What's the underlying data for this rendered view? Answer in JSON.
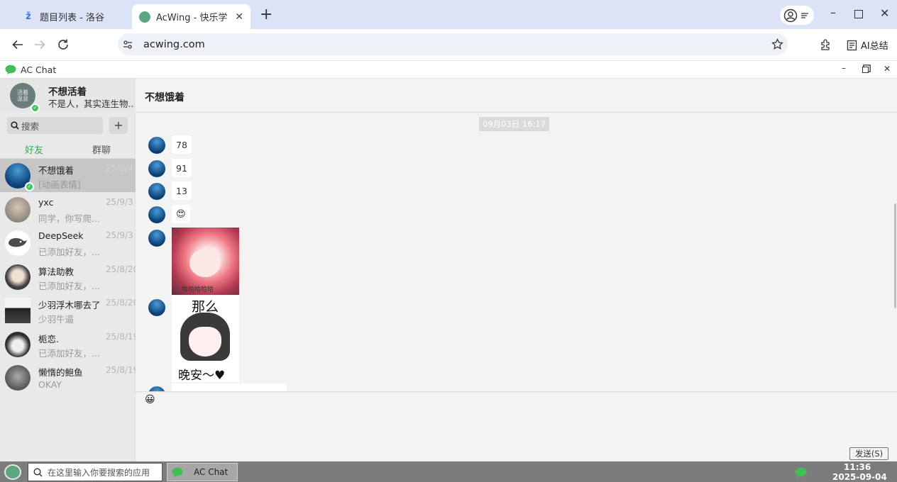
{
  "browser": {
    "tabs": [
      {
        "title": "题目列表 - 洛谷",
        "active": false
      },
      {
        "title": "AcWing - 快乐学习",
        "active": true
      }
    ],
    "new_tab": "+",
    "url": "acwing.com",
    "ai_button": "AI总结",
    "accent": "#dde3f6"
  },
  "app": {
    "title": "AC Chat",
    "profile": {
      "name": "不想活着",
      "status": "不是人，其实连生物..."
    },
    "search": {
      "placeholder": "搜索"
    },
    "add_label": "+",
    "tabs": [
      {
        "label": "好友",
        "active": true
      },
      {
        "label": "群聊",
        "active": false
      }
    ],
    "chats": [
      {
        "name": "不想饿着",
        "preview": "[动画表情]",
        "time": "25/9/4",
        "selected": true
      },
      {
        "name": "yxc",
        "preview": "同学，你写爬...",
        "time": "25/9/3",
        "selected": false
      },
      {
        "name": "DeepSeek",
        "preview": "已添加好友，...",
        "time": "25/9/3",
        "selected": false
      },
      {
        "name": "算法助教",
        "preview": "已添加好友，...",
        "time": "25/8/20",
        "selected": false
      },
      {
        "name": "少羽浮木哪去了",
        "preview": "少羽牛逼",
        "time": "25/8/20",
        "selected": false
      },
      {
        "name": "栀恋.",
        "preview": "已添加好友，...",
        "time": "25/8/19",
        "selected": false
      },
      {
        "name": "懒惰的鲍鱼",
        "preview": "OKAY",
        "time": "25/8/19",
        "selected": false
      }
    ],
    "conversation": {
      "title": "不想饿着",
      "timestamp": "09月03日 16:17",
      "messages": [
        "78",
        "91",
        "13",
        "😍"
      ],
      "sticker1_caption": "哈哈哈哈哈",
      "sticker2_top": "那么",
      "sticker2_bottom": "晚安～♥"
    },
    "emoji_button": "😀",
    "send_label": "发送(S)"
  },
  "taskbar": {
    "search_placeholder": "在这里输入你要搜索的应用",
    "app_label": "AC Chat",
    "time": "11:36",
    "date": "2025-09-04"
  }
}
